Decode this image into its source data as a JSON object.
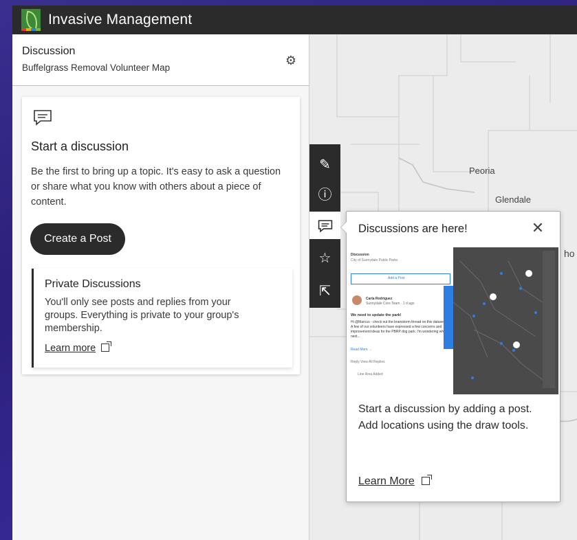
{
  "app": {
    "title": "Invasive Management",
    "logo_colors": [
      "#e03c31",
      "#f2a900",
      "#1e88e5",
      "#7cb342"
    ]
  },
  "panel": {
    "title": "Discussion",
    "subtitle": "Buffelgrass Removal Volunteer Map",
    "settings_icon": "gear-icon"
  },
  "empty_state": {
    "icon": "comment-icon",
    "heading": "Start a discussion",
    "description": "Be the first to bring up a topic. It's easy to ask a question or share what you know with others about a piece of content.",
    "create_button": "Create a Post"
  },
  "private": {
    "heading": "Private Discussions",
    "body": "You'll only see posts and replies from your groups. Everything is private to your group's membership.",
    "learn_more": "Learn more"
  },
  "map": {
    "labels": [
      "Peoria",
      "Glendale",
      "ho"
    ]
  },
  "toolbar": {
    "tools": [
      "pencil-icon",
      "info-icon",
      "comment-icon",
      "star-icon",
      "share-icon"
    ],
    "active_tool": "comment-icon"
  },
  "popover": {
    "title": "Discussions are here!",
    "body": "Start a discussion by adding a post. Add locations using the draw tools.",
    "learn_more": "Learn More",
    "preview": {
      "panel_title": "Discussion",
      "panel_subtitle": "City of Sunnydale Public Parks",
      "add_post": "Add a Post",
      "author": "Carla Rodriguez",
      "author_meta": "Sunnydale Core Team · 1 d ago",
      "post_title": "We need to update the park!",
      "post_body": "Hi @Marcus - check out the brainstorm thread on this dataset. A few of our volunteers have expressed a few concerns and improvement ideas for the PBRP dog park. I'm wondering what next...",
      "read_more": "Read More →",
      "reply": "Reply   View All Replies",
      "area": "Line Area Added"
    }
  },
  "colors": {
    "topbar": "#2b2b2b",
    "accent": "#2e7de0",
    "background": "#3a2f8f"
  }
}
